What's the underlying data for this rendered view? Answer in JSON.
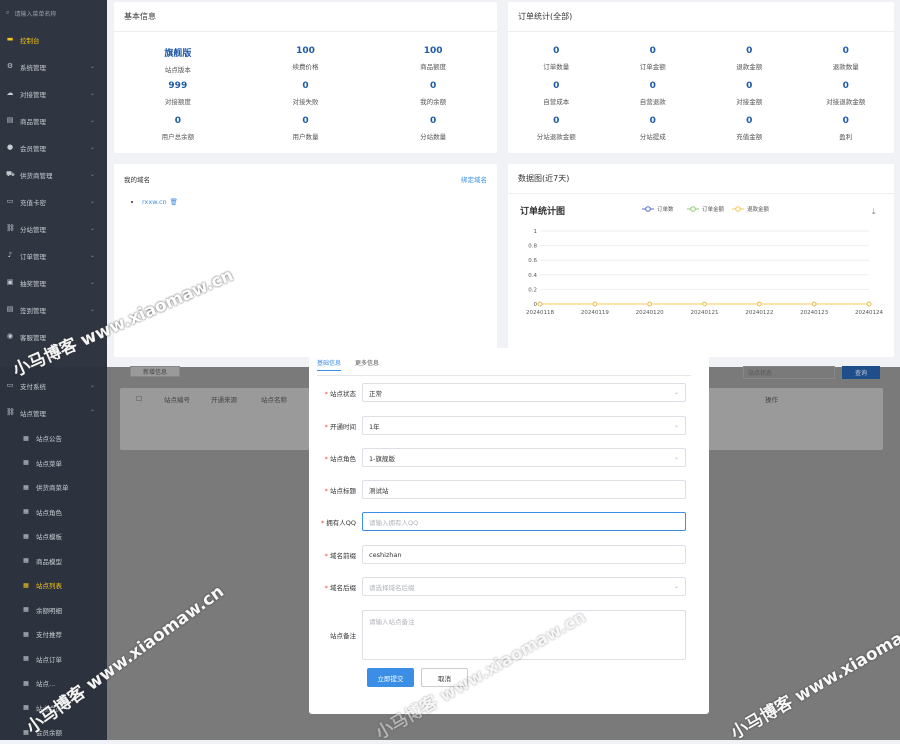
{
  "sidebar_top": {
    "search_placeholder": "请输入菜单名称",
    "items": [
      {
        "label": "控制台",
        "icon": "monitor-icon",
        "active": true
      },
      {
        "label": "系统管理",
        "icon": "gear-icon"
      },
      {
        "label": "对接管理",
        "icon": "cloud-icon"
      },
      {
        "label": "商品管理",
        "icon": "cart-icon"
      },
      {
        "label": "会员管理",
        "icon": "user-icon"
      },
      {
        "label": "供货商管理",
        "icon": "truck-icon"
      },
      {
        "label": "充值卡密",
        "icon": "card-icon"
      },
      {
        "label": "分站管理",
        "icon": "sitemap-icon"
      },
      {
        "label": "订单管理",
        "icon": "bell-icon"
      },
      {
        "label": "抽奖管理",
        "icon": "gift-icon"
      },
      {
        "label": "签到管理",
        "icon": "doc-icon"
      },
      {
        "label": "客服管理",
        "icon": "chat-icon"
      }
    ]
  },
  "sidebar_bottom": {
    "items": [
      {
        "label": "支付系统",
        "icon": "card-icon"
      },
      {
        "label": "站点管理",
        "icon": "sitemap-icon",
        "expanded": true
      }
    ],
    "subitems": [
      {
        "label": "站点公告"
      },
      {
        "label": "站点菜单"
      },
      {
        "label": "供货商菜单"
      },
      {
        "label": "站点角色"
      },
      {
        "label": "站点模板"
      },
      {
        "label": "商品模型"
      },
      {
        "label": "站点列表",
        "active": true
      },
      {
        "label": "余额明细"
      },
      {
        "label": "支付推荐"
      },
      {
        "label": "站点订单"
      },
      {
        "label": "站点..."
      },
      {
        "label": "站点会员"
      },
      {
        "label": "会员余额"
      }
    ]
  },
  "basic_info": {
    "title": "基本信息",
    "items": [
      {
        "value": "旗舰版",
        "label": "站点版本"
      },
      {
        "value": "100",
        "label": "续费价格"
      },
      {
        "value": "100",
        "label": "商品额度"
      },
      {
        "value": "999",
        "label": "对接额度"
      },
      {
        "value": "0",
        "label": "对接失败"
      },
      {
        "value": "0",
        "label": "我的余额"
      },
      {
        "value": "0",
        "label": "用户总余额"
      },
      {
        "value": "0",
        "label": "用户数量"
      },
      {
        "value": "0",
        "label": "分站数量"
      }
    ]
  },
  "order_stats": {
    "title": "订单统计(全部)",
    "items": [
      {
        "value": "0",
        "label": "订单数量"
      },
      {
        "value": "0",
        "label": "订单金额"
      },
      {
        "value": "0",
        "label": "退款金额"
      },
      {
        "value": "0",
        "label": "退款数量"
      },
      {
        "value": "0",
        "label": "自营成本"
      },
      {
        "value": "0",
        "label": "自营退款"
      },
      {
        "value": "0",
        "label": "对接金额"
      },
      {
        "value": "0",
        "label": "对接退款金额"
      },
      {
        "value": "0",
        "label": "分站退款金额"
      },
      {
        "value": "0",
        "label": "分站提成"
      },
      {
        "value": "0",
        "label": "充值金额"
      },
      {
        "value": "0",
        "label": "盈利"
      }
    ]
  },
  "domains": {
    "title": "我的域名",
    "bind_link": "绑定域名",
    "list": [
      "rxxw.cn"
    ]
  },
  "chart_panel": {
    "title": "数据图(近7天)"
  },
  "chart_data": {
    "type": "line",
    "title": "订单统计图",
    "categories": [
      "20240118",
      "20240119",
      "20240120",
      "20240121",
      "20240122",
      "20240123",
      "20240124"
    ],
    "yticks": [
      "0",
      "0.2",
      "0.4",
      "0.6",
      "0.8",
      "1"
    ],
    "ylim": [
      0,
      1
    ],
    "series": [
      {
        "name": "订单数",
        "color": "#5470c6",
        "values": [
          0,
          0,
          0,
          0,
          0,
          0,
          0
        ]
      },
      {
        "name": "订单金额",
        "color": "#91cc75",
        "values": [
          0,
          0,
          0,
          0,
          0,
          0,
          0
        ]
      },
      {
        "name": "退款金额",
        "color": "#fac858",
        "values": [
          0,
          0,
          0,
          0,
          0,
          0,
          0
        ]
      }
    ]
  },
  "background_list": {
    "add_button": "新增信息",
    "status_placeholder": "站点状态",
    "search_button": "查询",
    "columns": [
      "站点编号",
      "开通来源",
      "站点名称"
    ],
    "action_column": "操作"
  },
  "modal": {
    "tabs": [
      "基础信息",
      "更多信息"
    ],
    "fields": [
      {
        "label": "站点状态",
        "required": true,
        "value": "正常",
        "type": "select"
      },
      {
        "label": "开通时间",
        "required": true,
        "value": "1年",
        "type": "select"
      },
      {
        "label": "站点角色",
        "required": true,
        "value": "1-旗舰版",
        "type": "select"
      },
      {
        "label": "站点标题",
        "required": true,
        "value": "测试站",
        "type": "input"
      },
      {
        "label": "拥有人QQ",
        "required": true,
        "placeholder": "请输入拥有人QQ",
        "type": "input",
        "focus": true
      },
      {
        "label": "域名前缀",
        "required": true,
        "value": "ceshizhan",
        "type": "input"
      },
      {
        "label": "域名后缀",
        "required": true,
        "placeholder": "请选择域名后缀",
        "type": "select"
      },
      {
        "label": "站点备注",
        "required": false,
        "placeholder": "请输入站点备注",
        "type": "textarea"
      }
    ],
    "submit": "立即提交",
    "cancel": "取消"
  },
  "watermarks": [
    "小马博客 www.xiaomaw.cn",
    "小马博客 www.xiaomaw.cn",
    "小马博客 www.xiaomaw.cn",
    "小马博客 www.xiaomaw.cn"
  ]
}
